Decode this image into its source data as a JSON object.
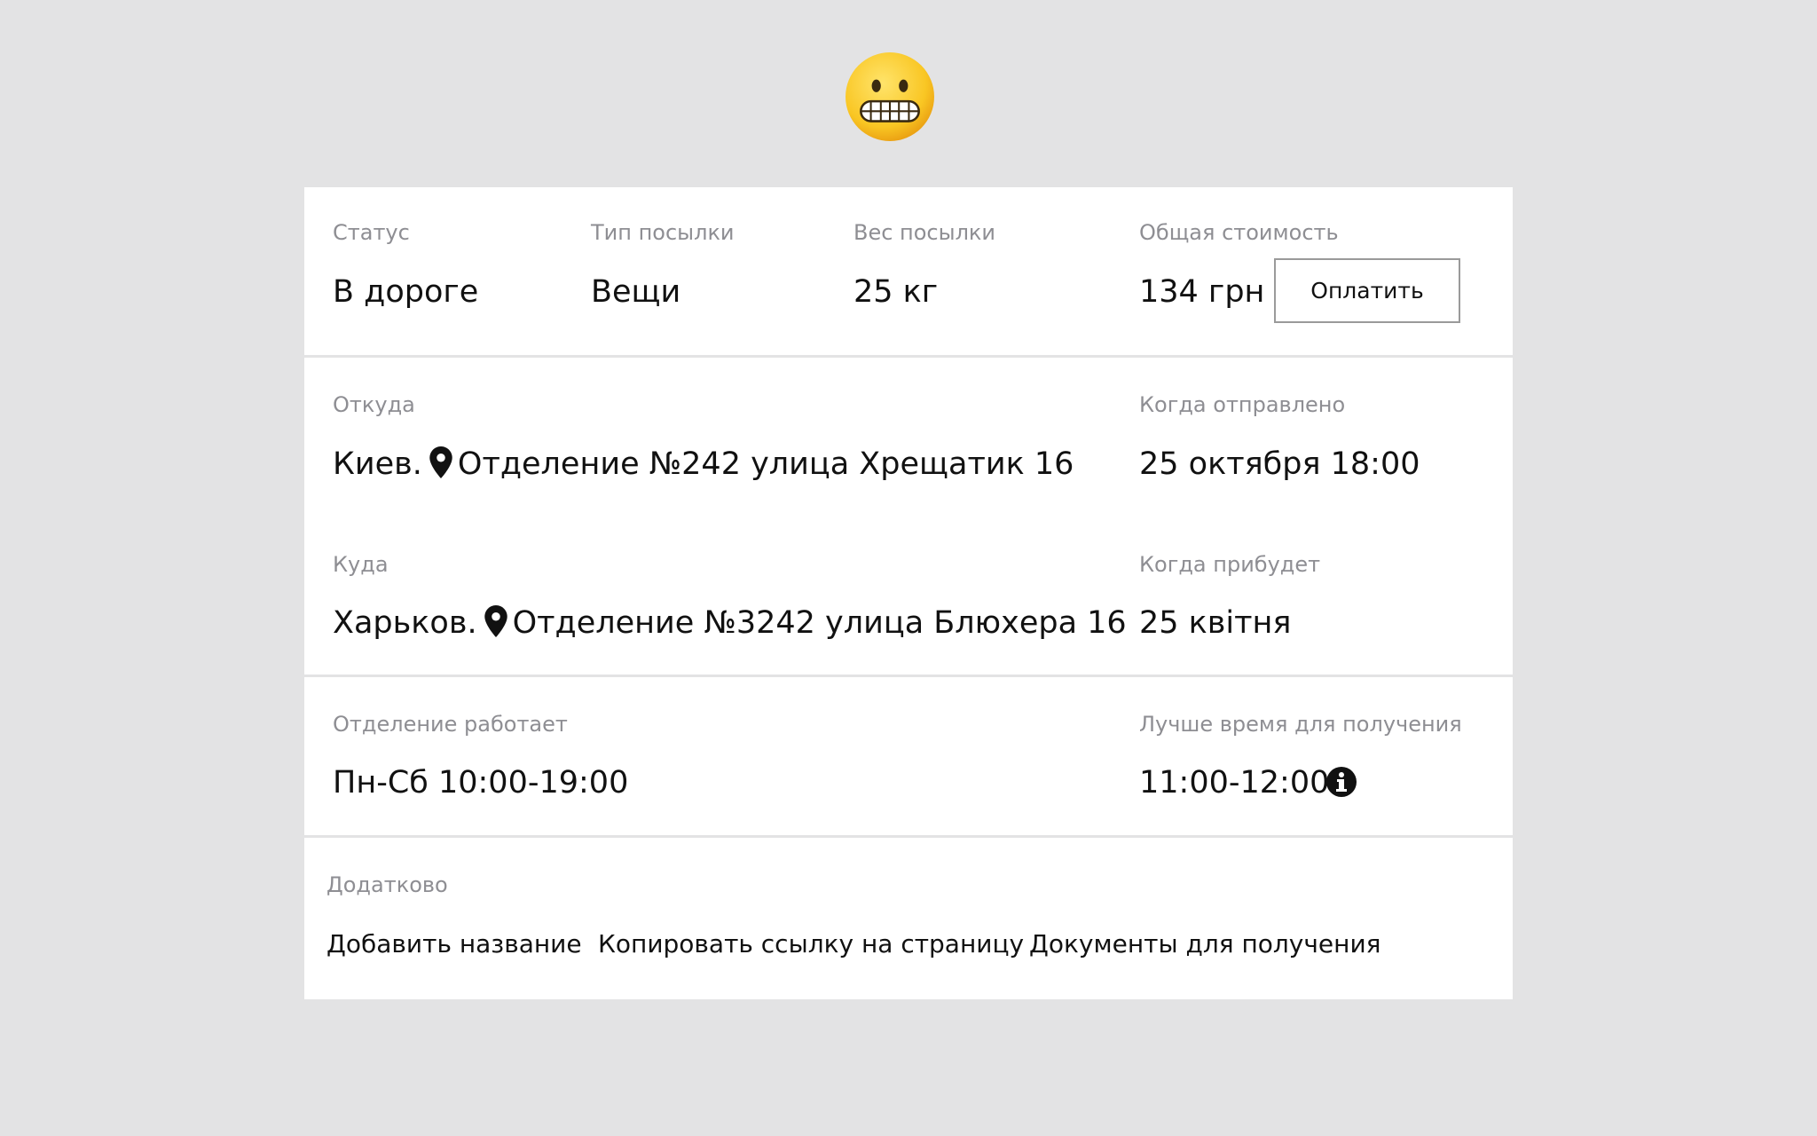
{
  "icons": {
    "top_emoji": "grimacing-face-icon",
    "location": "map-pin-icon",
    "info": "info-circle-icon"
  },
  "summary": {
    "status": {
      "label": "Статус",
      "value": "В дороге"
    },
    "type": {
      "label": "Тип посылки",
      "value": "Вещи"
    },
    "weight": {
      "label": "Вес посылки",
      "value": "25 кг"
    },
    "total": {
      "label": "Общая стоимость",
      "value": "134 грн"
    },
    "pay_button": "Оплатить"
  },
  "route": {
    "from": {
      "label": "Откуда",
      "city": "Киев.",
      "address": "Отделение №242 улица Хрещатик 16"
    },
    "sent": {
      "label": "Когда отправлено",
      "value": "25 октября 18:00"
    },
    "to": {
      "label": "Куда",
      "city": "Харьков.",
      "address": "Отделение №3242 улица Блюхера 16"
    },
    "arrive": {
      "label": "Когда прибудет",
      "value": "25 квітня"
    }
  },
  "schedule": {
    "hours": {
      "label": "Отделение работает",
      "value": "Пн-Сб 10:00-19:00"
    },
    "best_time": {
      "label": "Лучше время для получения",
      "value": "11:00-12:00"
    }
  },
  "extra": {
    "label": "Додатково",
    "links": [
      "Добавить название",
      "Копировать ссылку на страницу",
      "Документы для получения"
    ]
  },
  "colors": {
    "background": "#e3e3e4",
    "card": "#ffffff",
    "label": "#8e8e93",
    "text": "#111111",
    "emoji": "#f9c623"
  }
}
